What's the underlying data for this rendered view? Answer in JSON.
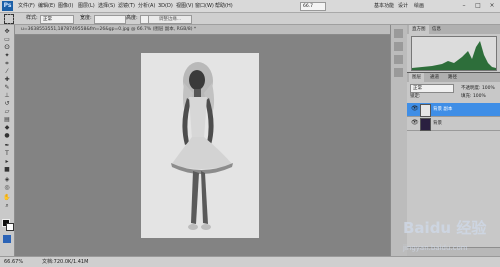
{
  "menubar": {
    "logo": "Ps",
    "items": [
      "文件(F)",
      "编辑(E)",
      "图像(I)",
      "图层(L)",
      "选择(S)",
      "滤镜(T)",
      "分析(A)",
      "3D(D)",
      "视图(V)",
      "窗口(W)",
      "帮助(H)"
    ],
    "zoom": "66.7",
    "workspaces": [
      "基本功能",
      "设计",
      "绘画"
    ],
    "window_controls": [
      "–",
      "□",
      "×"
    ]
  },
  "options": {
    "tool_icon": "marquee-icon",
    "mode_label": "样式:",
    "mode_value": "正常",
    "width_label": "宽度:",
    "height_label": "高度:",
    "refine_button": "调整边缘..."
  },
  "document": {
    "tab_title": "u=3638553551,1878749558&fm=26&gp=0.jpg @ 66.7% (图层 副本, RGB/8) *",
    "close_icon": "×"
  },
  "status": {
    "zoom": "66.67%",
    "doc_info": "文档:720.0K/1.41M"
  },
  "panels": {
    "histogram_tabs": [
      "直方图",
      "信息"
    ],
    "layers_tabs": [
      "图层",
      "通道",
      "路径"
    ],
    "blend_mode": "正常",
    "opacity_label": "不透明度: 100%",
    "fill_label": "填充: 100%",
    "lock_label": "锁定:",
    "layers": [
      {
        "name": "背景 副本",
        "selected": true
      },
      {
        "name": "背景",
        "selected": false
      }
    ]
  },
  "watermark": {
    "brand": "Baidu 经验",
    "url": "jingyan.baidu.com"
  }
}
